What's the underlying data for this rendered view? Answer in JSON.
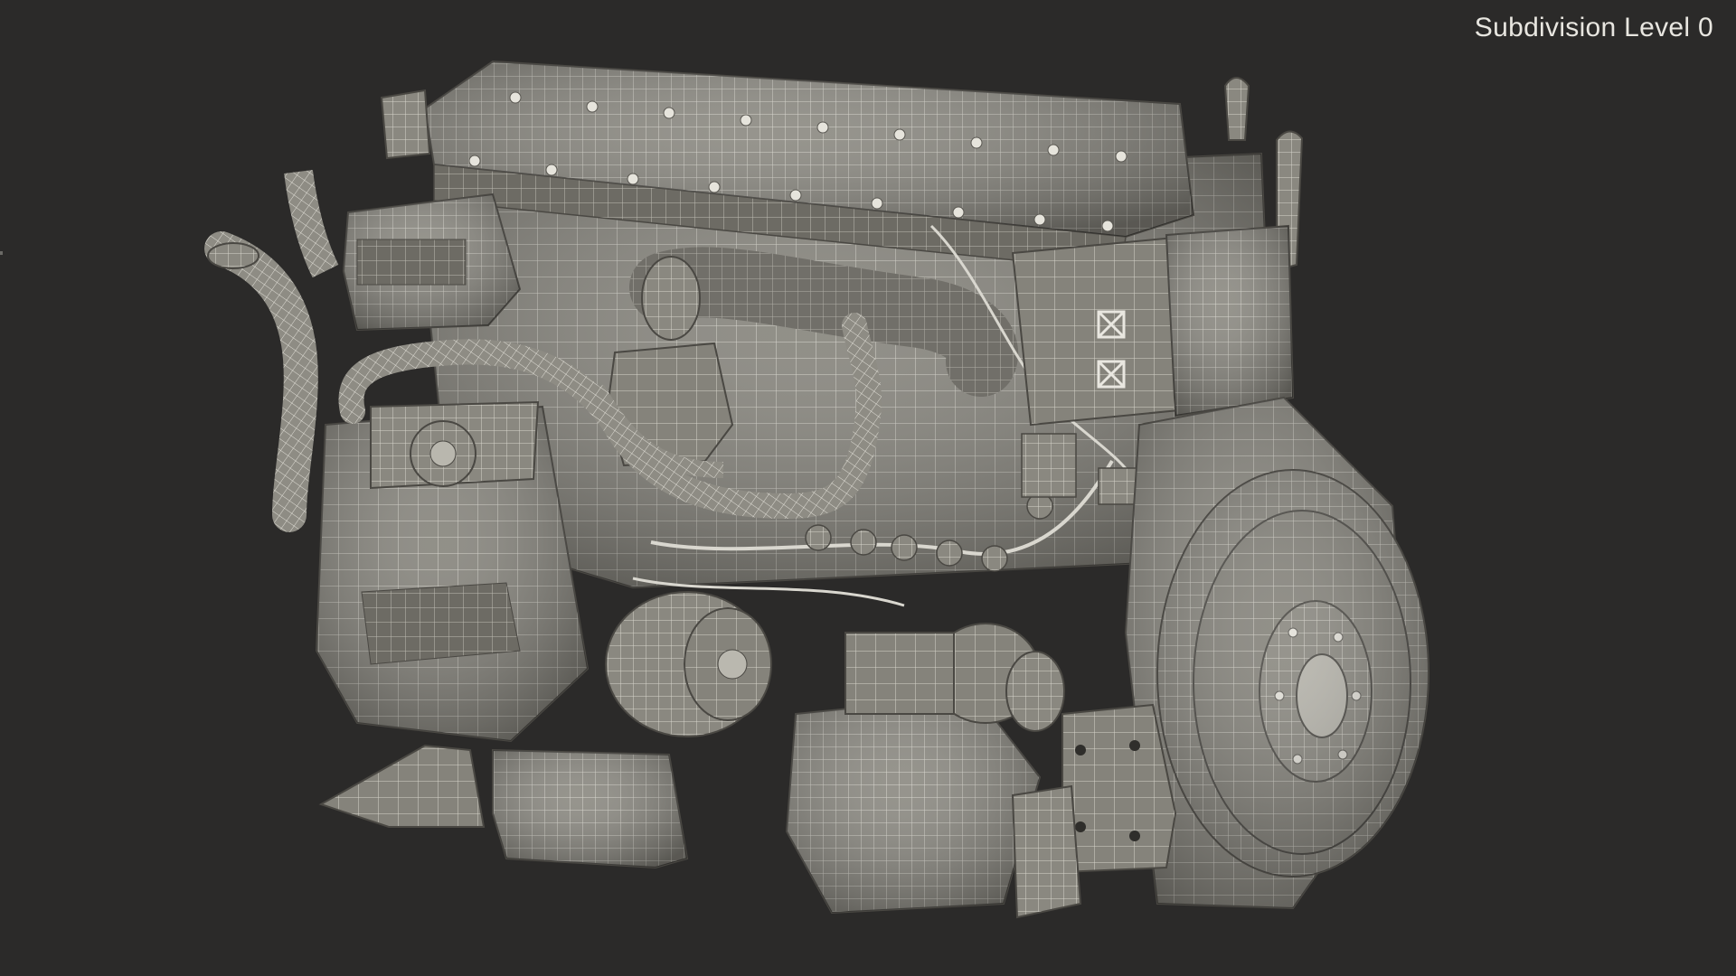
{
  "overlay": {
    "subdivision_label": "Subdivision Level 0"
  },
  "scene": {
    "subject": "engine-wireframe",
    "background_color": "#2b2a29",
    "mesh_fill_color": "#8d8b83",
    "mesh_wire_color": "#dcdad2",
    "mesh_shadow_color": "#55534e"
  }
}
